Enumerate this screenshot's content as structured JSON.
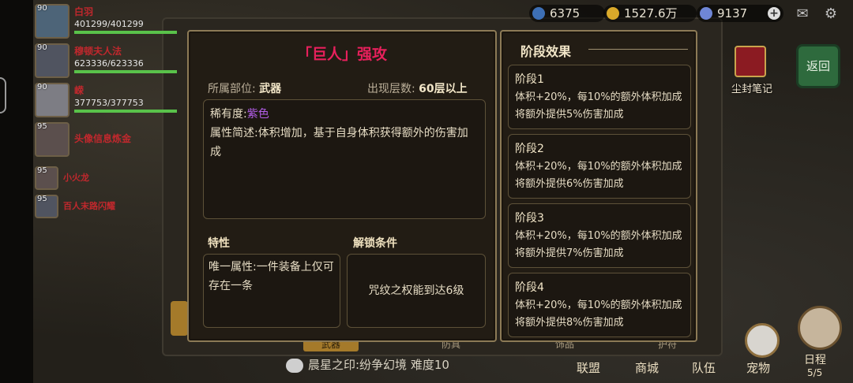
{
  "background": {
    "team": [
      {
        "level": "90",
        "name": "白羽",
        "hp": "401299/401299"
      },
      {
        "level": "90",
        "name": "穆顿夫人法",
        "hp": "623336/623336"
      },
      {
        "level": "90",
        "name": "嵘",
        "hp": "377753/377753"
      }
    ],
    "team_extra": [
      {
        "level": "95",
        "name": "头像信息炼金"
      },
      {
        "level": "95",
        "name": "小火龙"
      },
      {
        "level": "95",
        "name": "百人末路闪耀"
      }
    ],
    "resources": {
      "res1": "6375",
      "gold": "1527.6万",
      "gems": "9137"
    },
    "notebook_label": "尘封笔记",
    "return_label": "返回",
    "bottom_tabs": [
      "武器",
      "防具",
      "饰品",
      "护符"
    ],
    "chat_text": "晨星之印:纷争幻境 难度10",
    "nav": {
      "alliance": "联盟",
      "shop": "商城",
      "team": "队伍",
      "pet": "宠物",
      "schedule": "日程",
      "schedule_count": "5/5"
    }
  },
  "dialog": {
    "title": "「巨人」强攻",
    "slot_label": "所属部位:",
    "slot_value": "武器",
    "floor_label": "出现层数:",
    "floor_value": "60层以上",
    "rarity_label": "稀有度:",
    "rarity_value": "紫色",
    "desc_label": "属性简述:",
    "desc_text": "体积增加，基于自身体积获得额外的伤害加成",
    "trait_header": "特性",
    "trait_text": "唯一属性:一件装备上仅可存在一条",
    "unlock_header": "解锁条件",
    "unlock_text": "咒纹之权能到达6级",
    "stages_header": "阶段效果",
    "stages": [
      {
        "name": "阶段1",
        "desc": "体积+20%，每10%的额外体积加成将额外提供5%伤害加成"
      },
      {
        "name": "阶段2",
        "desc": "体积+20%，每10%的额外体积加成将额外提供6%伤害加成"
      },
      {
        "name": "阶段3",
        "desc": "体积+20%，每10%的额外体积加成将额外提供7%伤害加成"
      },
      {
        "name": "阶段4",
        "desc": "体积+20%，每10%的额外体积加成将额外提供8%伤害加成"
      }
    ]
  },
  "colors": {
    "title": "#e8205c",
    "rarity_purple": "#b35ee8",
    "frame": "#8c7a56"
  }
}
